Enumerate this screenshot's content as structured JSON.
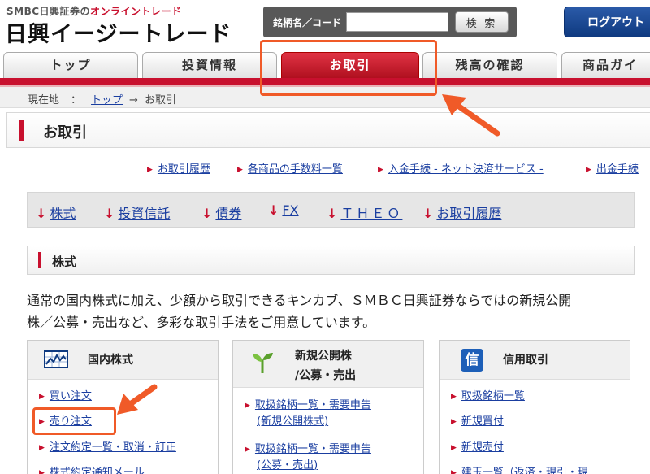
{
  "header": {
    "brand_sub_prefix": "SMBC日興証券の",
    "brand_sub_accent": "オンライントレード",
    "brand_main": "日興イージートレード",
    "search_label": "銘柄名／コード",
    "search_value": "",
    "search_button": "検 索",
    "logout": "ログアウト"
  },
  "nav": {
    "tabs": [
      {
        "label": "トップ"
      },
      {
        "label": "投資情報"
      },
      {
        "label": "お取引",
        "active": true
      },
      {
        "label": "残高の確認"
      },
      {
        "label": "商品ガイ"
      }
    ]
  },
  "breadcrumb": {
    "prefix": "現在地",
    "sep": "：",
    "home": "トップ",
    "arrow": "→",
    "current": "お取引"
  },
  "page_title": "お取引",
  "quick_links": [
    "お取引履歴",
    "各商品の手数料一覧",
    "入金手続 - ネット決済サービス -",
    "出金手続"
  ],
  "anchor_links": [
    "株式",
    "投資信託",
    "債券",
    "FX",
    "ＴＨＥＯ",
    "お取引履歴"
  ],
  "section": {
    "title": "株式",
    "description_line1": "通常の国内株式に加え、少額から取引できるキンカブ、ＳＭＢＣ日興証券ならではの新規公開",
    "description_line2": "株／公募・売出など、多彩な取引手法をご用意しています。"
  },
  "cards": [
    {
      "title": "国内株式",
      "icon": "chart-icon",
      "links": [
        "買い注文",
        "売り注文",
        "注文約定一覧・取消・訂正",
        "株式約定通知メール"
      ]
    },
    {
      "title_line1": "新規公開株",
      "title_line2": "/公募・売出",
      "icon": "sprout-icon",
      "links": [
        {
          "line1": "取扱銘柄一覧・需要申告",
          "line2": "(新規公開株式)"
        },
        {
          "line1": "取扱銘柄一覧・需要申告",
          "line2": "(公募・売出)"
        }
      ]
    },
    {
      "title": "信用取引",
      "icon": "shin-icon",
      "icon_char": "信",
      "links": [
        "取扱銘柄一覧",
        "新規買付",
        "新規売付",
        "建玉一覧（返済・現引・現"
      ]
    }
  ],
  "colors": {
    "brand_red": "#c8102e",
    "link_blue": "#1a3ea0",
    "logout_blue": "#0f3a80",
    "callout_orange": "#f05a28"
  }
}
